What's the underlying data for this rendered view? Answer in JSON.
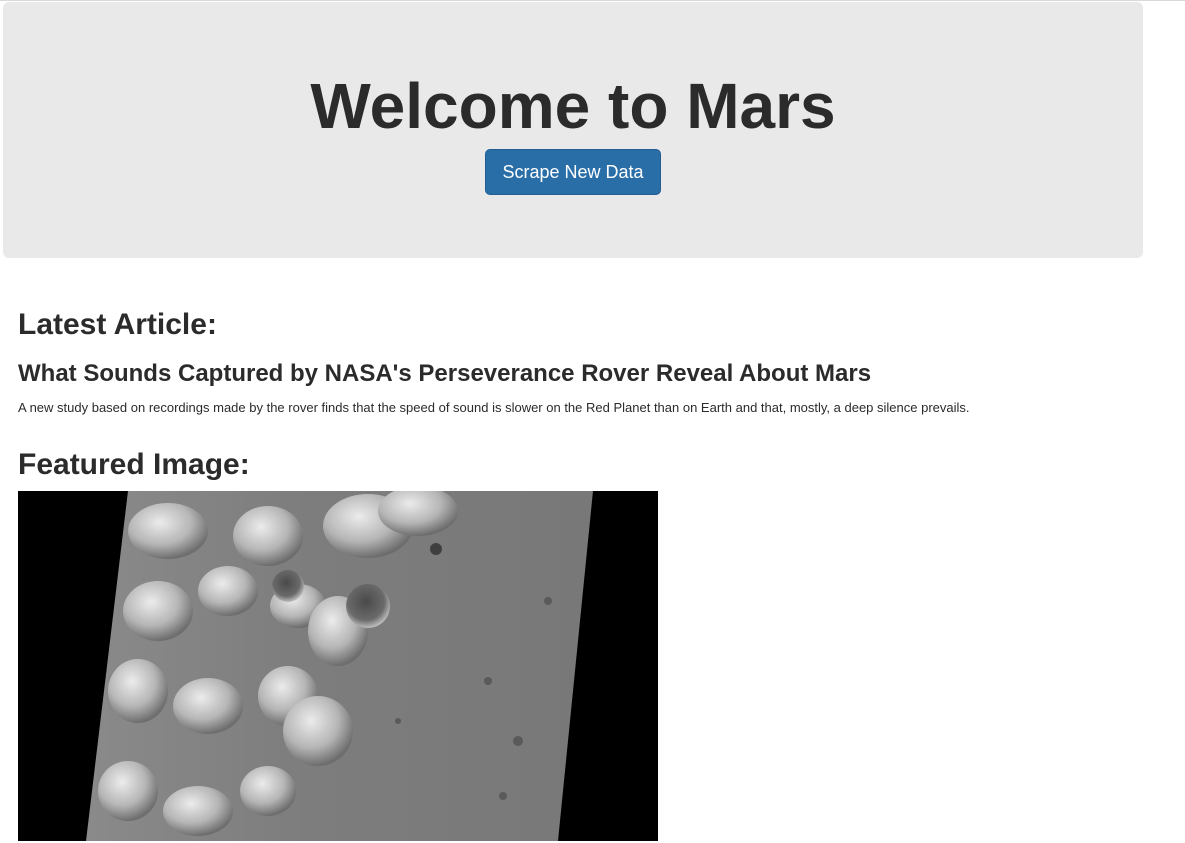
{
  "jumbotron": {
    "title": "Welcome to Mars",
    "button_label": "Scrape New Data",
    "background": "#e9e9e9",
    "button_color": "#2a6ea8"
  },
  "article": {
    "section_heading": "Latest Article:",
    "title": "What Sounds Captured by NASA's Perseverance Rover Reveal About Mars",
    "teaser": "A new study based on recordings made by the rover finds that the speed of sound is slower on the Red Planet than on Earth and that, mostly, a deep silence prevails."
  },
  "featured": {
    "section_heading": "Featured Image:",
    "image_description": "grayscale Mars orbital surface image"
  }
}
